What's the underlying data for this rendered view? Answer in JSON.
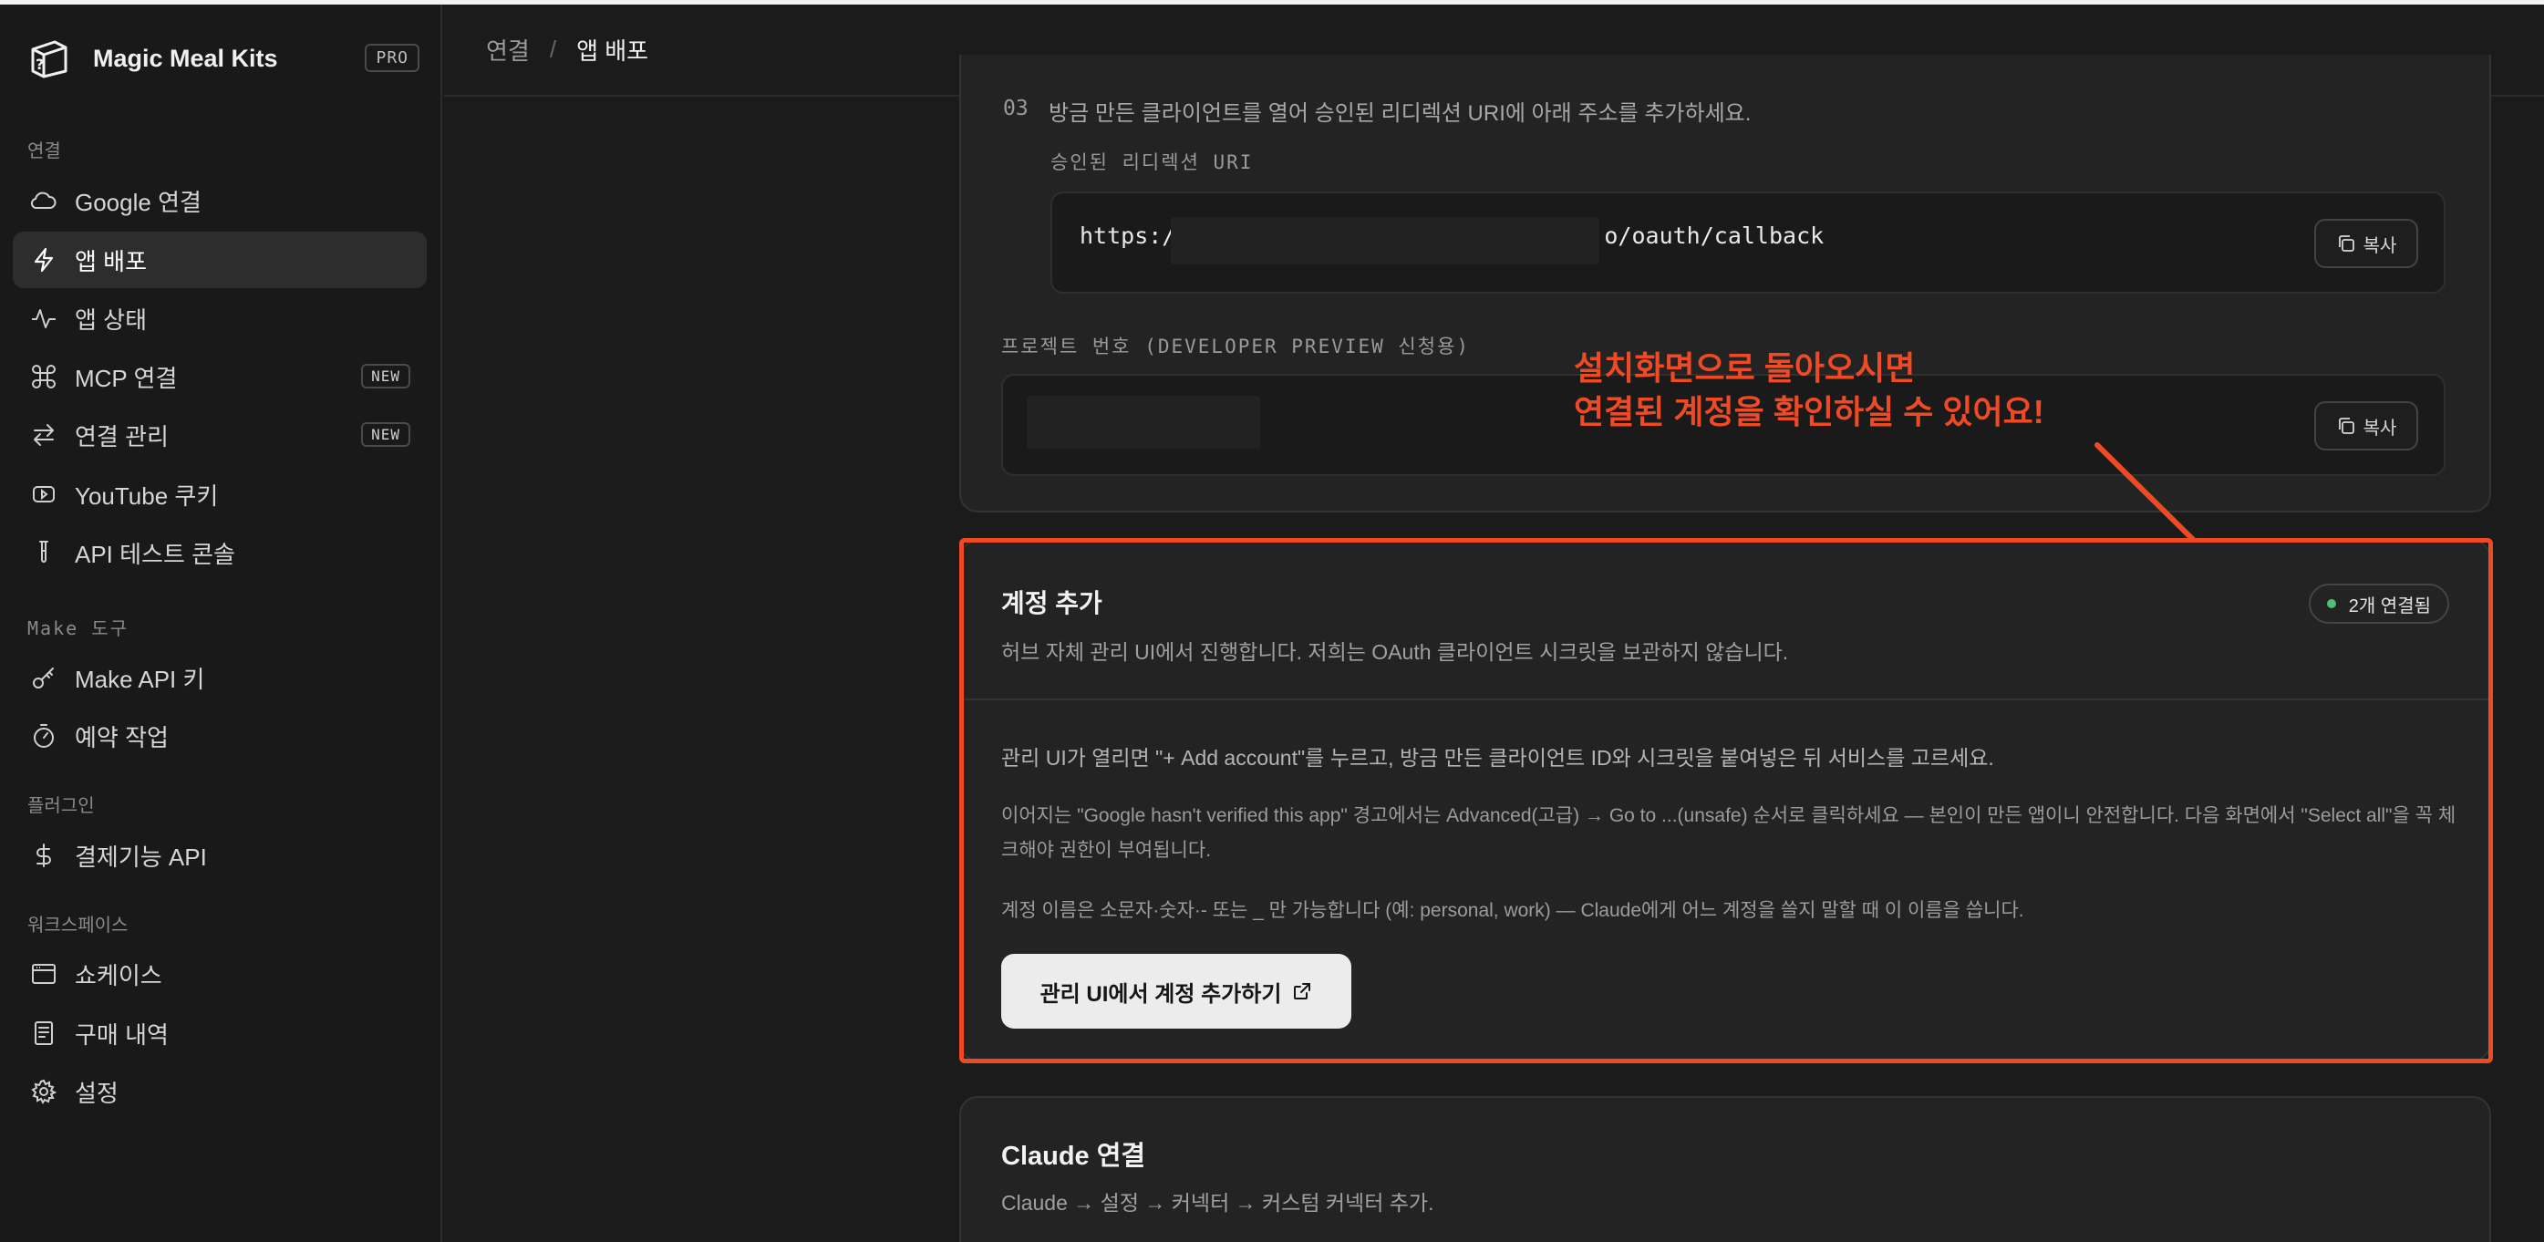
{
  "brand": {
    "name": "Magic Meal Kits",
    "badge": "PRO"
  },
  "sidebar": {
    "sections": [
      {
        "label": "연결"
      },
      {
        "label": "Make 도구"
      },
      {
        "label": "플러그인"
      },
      {
        "label": "워크스페이스"
      }
    ],
    "items": [
      {
        "label": "Google 연결",
        "icon": "cloud-icon"
      },
      {
        "label": "앱 배포",
        "icon": "bolt-icon",
        "active": true
      },
      {
        "label": "앱 상태",
        "icon": "activity-icon"
      },
      {
        "label": "MCP 연결",
        "icon": "command-icon",
        "badge": "NEW"
      },
      {
        "label": "연결 관리",
        "icon": "arrows-icon",
        "badge": "NEW"
      },
      {
        "label": "YouTube 쿠키",
        "icon": "youtube-icon"
      },
      {
        "label": "API 테스트 콘솔",
        "icon": "test-tube-icon"
      },
      {
        "label": "Make API 키",
        "icon": "key-icon"
      },
      {
        "label": "예약 작업",
        "icon": "timer-icon"
      },
      {
        "label": "결제기능 API",
        "icon": "dollar-icon"
      },
      {
        "label": "쇼케이스",
        "icon": "browser-icon"
      },
      {
        "label": "구매 내역",
        "icon": "receipt-icon"
      },
      {
        "label": "설정",
        "icon": "gear-icon"
      }
    ]
  },
  "breadcrumb": {
    "parent": "연결",
    "separator": "/",
    "current": "앱 배포"
  },
  "step": {
    "number": "03",
    "text": "방금 만든 클라이언트를 열어 승인된 리디렉션 URI에 아래 주소를 추가하세요.",
    "uri_label": "승인된 리디렉션 URI",
    "uri_prefix": "https:/",
    "uri_suffix": "o/oauth/callback",
    "copy_label": "복사",
    "project_label": "프로젝트 번호 (DEVELOPER PREVIEW 신청용)"
  },
  "annotation": {
    "line1": "설치화면으로 돌아오시면",
    "line2": "연결된 계정을 확인하실 수 있어요!",
    "color": "#f04a25"
  },
  "account": {
    "title": "계정 추가",
    "subtitle": "허브 자체 관리 UI에서 진행합니다. 저희는 OAuth 클라이언트 시크릿을 보관하지 않습니다.",
    "status": "2개 연결됨",
    "status_color": "#4fbf75",
    "p1": "관리 UI가 열리면 \"+ Add account\"를 누르고, 방금 만든 클라이언트 ID와 시크릿을 붙여넣은 뒤 서비스를 고르세요.",
    "p2": "이어지는 \"Google hasn't verified this app\" 경고에서는 Advanced(고급) → Go to ...(unsafe) 순서로 클릭하세요 — 본인이 만든 앱이니 안전합니다. 다음 화면에서 \"Select all\"을 꼭 체크해야 권한이 부여됩니다.",
    "p3": "계정 이름은 소문자·숫자·- 또는 _ 만 가능합니다 (예: personal, work) — Claude에게 어느 계정을 쓸지 말할 때 이 이름을 씁니다.",
    "cta": "관리 UI에서 계정 추가하기"
  },
  "claude": {
    "title": "Claude 연결",
    "subtitle": "Claude → 설정 → 커넥터 → 커스텀 커넥터 추가."
  }
}
